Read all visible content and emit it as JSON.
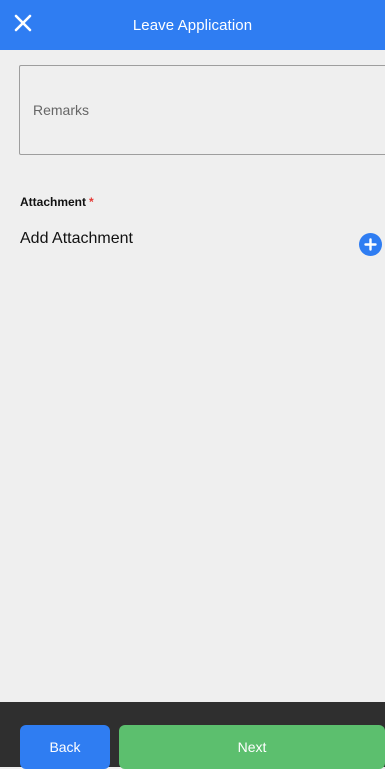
{
  "header": {
    "title": "Leave Application",
    "close_icon": "close-icon",
    "background_color": "#2f7df2"
  },
  "remarks": {
    "placeholder": "Remarks",
    "value": ""
  },
  "attachment": {
    "label": "Attachment",
    "required_marker": "*",
    "add_text": "Add Attachment",
    "add_icon": "plus-circle-icon"
  },
  "footer": {
    "back_label": "Back",
    "next_label": "Next",
    "back_color": "#2f7df2",
    "next_color": "#5cbf6e"
  }
}
